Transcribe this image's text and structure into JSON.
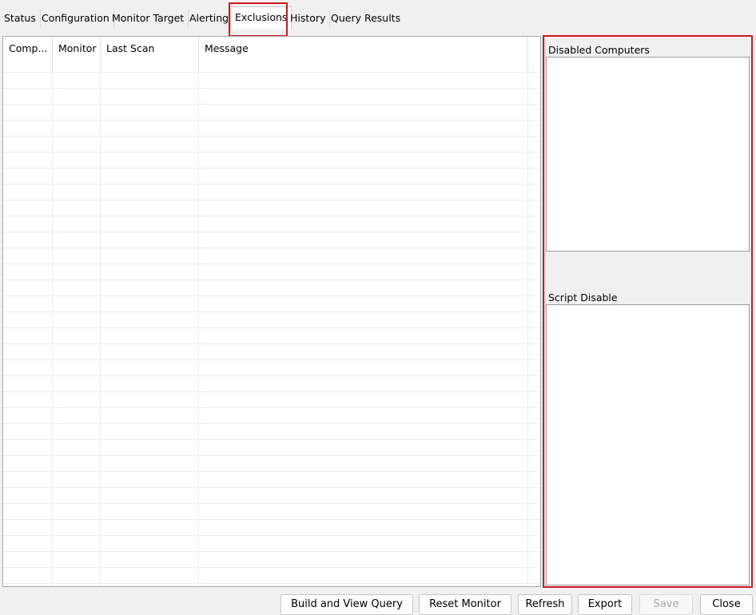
{
  "tabs": [
    {
      "label": "Status",
      "active": false
    },
    {
      "label": "Configuration",
      "active": false
    },
    {
      "label": "Monitor Target",
      "active": false
    },
    {
      "label": "Alerting",
      "active": false
    },
    {
      "label": "Exclusions",
      "active": true
    },
    {
      "label": "History",
      "active": false
    },
    {
      "label": "Query Results",
      "active": false
    }
  ],
  "grid": {
    "columns": [
      "Comp...",
      "Monitor",
      "Last Scan",
      "Message"
    ]
  },
  "side": {
    "disabled_computers_label": "Disabled Computers",
    "script_disable_label": "Script Disable"
  },
  "buttons": {
    "build_view_query": "Build and View Query",
    "reset_monitor": "Reset Monitor",
    "refresh": "Refresh",
    "export": "Export",
    "save": "Save",
    "close": "Close"
  },
  "colors": {
    "highlight": "#d0181e"
  }
}
